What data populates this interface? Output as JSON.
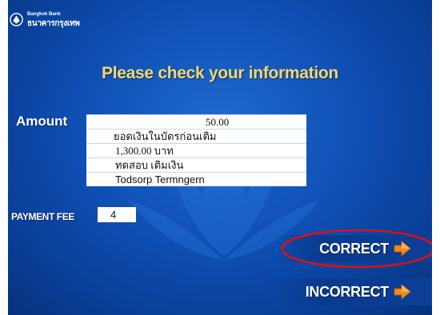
{
  "brand": {
    "name_en": "Bangkok Bank",
    "name_th": "ธนาคารกรุงเทพ",
    "logo_icon": "bangkok-bank-lotus-logo"
  },
  "headline": "Please check your information",
  "amount_label": "Amount",
  "info_rows": [
    "50.00",
    "ยอดเงินในบัตรก่อนเติม",
    "1,300.00 บาท",
    "ทดสอบ เติมเงิน",
    "Todsorp Termngern"
  ],
  "payment_fee": {
    "label": "PAYMENT FEE",
    "value": "4"
  },
  "buttons": {
    "correct": "CORRECT",
    "incorrect": "INCORRECT",
    "arrow_icon": "orange-arrow-icon"
  },
  "colors": {
    "background": "#0f4fb4",
    "headline": "#f3d86c",
    "arrow": "#f08a1c",
    "highlight": "#e01010"
  }
}
